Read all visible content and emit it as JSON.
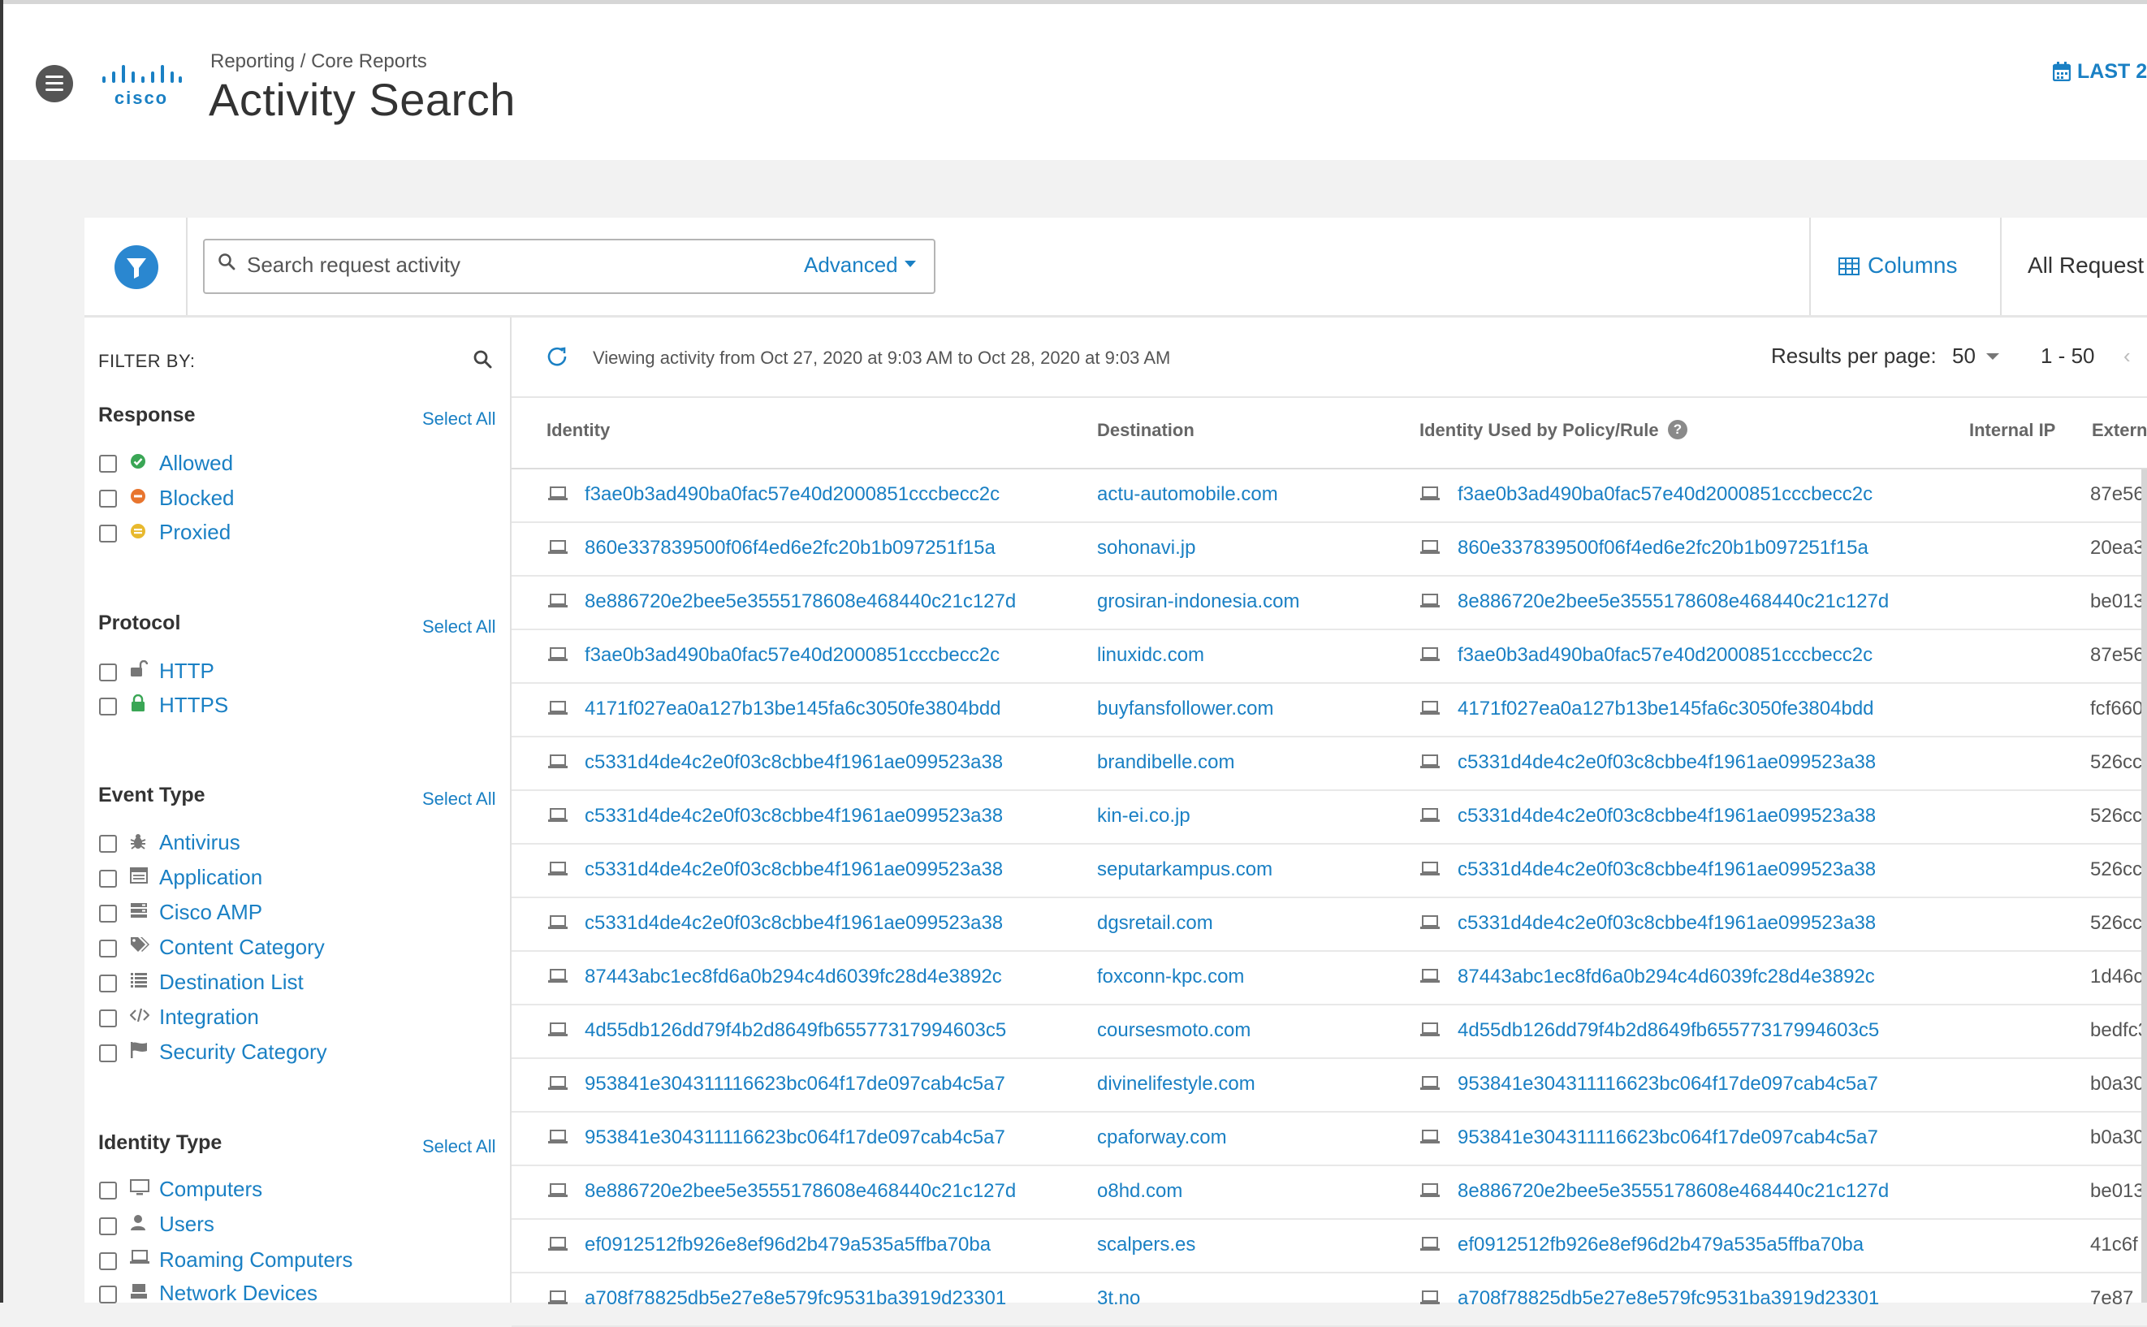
{
  "header": {
    "breadcrumb": "Reporting / Core Reports",
    "title": "Activity Search",
    "date_range": "LAST 2"
  },
  "toolbar": {
    "search_placeholder": "Search request activity",
    "advanced_label": "Advanced",
    "columns_label": "Columns",
    "all_requests_label": "All Request"
  },
  "sidebar": {
    "filter_by": "FILTER BY:",
    "sections": [
      {
        "title": "Response",
        "select_all": "Select All",
        "options": [
          {
            "label": "Allowed",
            "icon": "check-circle-icon",
            "color": "#3aa655"
          },
          {
            "label": "Blocked",
            "icon": "minus-circle-icon",
            "color": "#e8752e"
          },
          {
            "label": "Proxied",
            "icon": "proxy-circle-icon",
            "color": "#e8b92e"
          }
        ]
      },
      {
        "title": "Protocol",
        "select_all": "Select All",
        "options": [
          {
            "label": "HTTP",
            "icon": "unlock-icon",
            "color": "#777777"
          },
          {
            "label": "HTTPS",
            "icon": "lock-icon",
            "color": "#3aa655"
          }
        ]
      },
      {
        "title": "Event Type",
        "select_all": "Select All",
        "options": [
          {
            "label": "Antivirus",
            "icon": "bug-icon"
          },
          {
            "label": "Application",
            "icon": "application-icon"
          },
          {
            "label": "Cisco AMP",
            "icon": "server-icon"
          },
          {
            "label": "Content Category",
            "icon": "tags-icon"
          },
          {
            "label": "Destination List",
            "icon": "list-icon"
          },
          {
            "label": "Integration",
            "icon": "code-icon"
          },
          {
            "label": "Security Category",
            "icon": "flag-icon"
          }
        ]
      },
      {
        "title": "Identity Type",
        "select_all": "Select All",
        "options": [
          {
            "label": "Computers",
            "icon": "monitor-icon"
          },
          {
            "label": "Users",
            "icon": "user-icon"
          },
          {
            "label": "Roaming Computers",
            "icon": "laptop-icon"
          },
          {
            "label": "Network Devices",
            "icon": "network-device-icon"
          }
        ]
      }
    ]
  },
  "main": {
    "viewing_text": "Viewing activity from Oct 27, 2020 at 9:03 AM to Oct 28, 2020 at 9:03 AM",
    "results_per_page_label": "Results per page:",
    "results_per_page": "50",
    "page_range": "1 - 50",
    "columns": [
      "Identity",
      "Destination",
      "Identity Used by Policy/Rule",
      "Internal IP",
      "Extern"
    ],
    "rows": [
      {
        "identity": "f3ae0b3ad490ba0fac57e40d2000851cccbecc2c",
        "destination": "actu-automobile.com",
        "policy": "f3ae0b3ad490ba0fac57e40d2000851cccbecc2c",
        "external": "87e56"
      },
      {
        "identity": "860e337839500f06f4ed6e2fc20b1b097251f15a",
        "destination": "sohonavi.jp",
        "policy": "860e337839500f06f4ed6e2fc20b1b097251f15a",
        "external": "20ea3"
      },
      {
        "identity": "8e886720e2bee5e3555178608e468440c21c127d",
        "destination": "grosiran-indonesia.com",
        "policy": "8e886720e2bee5e3555178608e468440c21c127d",
        "external": "be013"
      },
      {
        "identity": "f3ae0b3ad490ba0fac57e40d2000851cccbecc2c",
        "destination": "linuxidc.com",
        "policy": "f3ae0b3ad490ba0fac57e40d2000851cccbecc2c",
        "external": "87e56"
      },
      {
        "identity": "4171f027ea0a127b13be145fa6c3050fe3804bdd",
        "destination": "buyfansfollower.com",
        "policy": "4171f027ea0a127b13be145fa6c3050fe3804bdd",
        "external": "fcf660"
      },
      {
        "identity": "c5331d4de4c2e0f03c8cbbe4f1961ae099523a38",
        "destination": "brandibelle.com",
        "policy": "c5331d4de4c2e0f03c8cbbe4f1961ae099523a38",
        "external": "526cc"
      },
      {
        "identity": "c5331d4de4c2e0f03c8cbbe4f1961ae099523a38",
        "destination": "kin-ei.co.jp",
        "policy": "c5331d4de4c2e0f03c8cbbe4f1961ae099523a38",
        "external": "526cc"
      },
      {
        "identity": "c5331d4de4c2e0f03c8cbbe4f1961ae099523a38",
        "destination": "seputarkampus.com",
        "policy": "c5331d4de4c2e0f03c8cbbe4f1961ae099523a38",
        "external": "526cc"
      },
      {
        "identity": "c5331d4de4c2e0f03c8cbbe4f1961ae099523a38",
        "destination": "dgsretail.com",
        "policy": "c5331d4de4c2e0f03c8cbbe4f1961ae099523a38",
        "external": "526cc"
      },
      {
        "identity": "87443abc1ec8fd6a0b294c4d6039fc28d4e3892c",
        "destination": "foxconn-kpc.com",
        "policy": "87443abc1ec8fd6a0b294c4d6039fc28d4e3892c",
        "external": "1d46c"
      },
      {
        "identity": "4d55db126dd79f4b2d8649fb65577317994603c5",
        "destination": "coursesmoto.com",
        "policy": "4d55db126dd79f4b2d8649fb65577317994603c5",
        "external": "bedfc3"
      },
      {
        "identity": "953841e304311116623bc064f17de097cab4c5a7",
        "destination": "divinelifestyle.com",
        "policy": "953841e304311116623bc064f17de097cab4c5a7",
        "external": "b0a30"
      },
      {
        "identity": "953841e304311116623bc064f17de097cab4c5a7",
        "destination": "cpaforway.com",
        "policy": "953841e304311116623bc064f17de097cab4c5a7",
        "external": "b0a30"
      },
      {
        "identity": "8e886720e2bee5e3555178608e468440c21c127d",
        "destination": "o8hd.com",
        "policy": "8e886720e2bee5e3555178608e468440c21c127d",
        "external": "be013"
      },
      {
        "identity": "ef0912512fb926e8ef96d2b479a535a5ffba70ba",
        "destination": "scalpers.es",
        "policy": "ef0912512fb926e8ef96d2b479a535a5ffba70ba",
        "external": "41c6f"
      },
      {
        "identity": "a708f78825db5e27e8e579fc9531ba3919d23301",
        "destination": "3t.no",
        "policy": "a708f78825db5e27e8e579fc9531ba3919d23301",
        "external": "7e87"
      }
    ]
  },
  "colors": {
    "accent": "#1a80c4",
    "filter_button": "#2a87d0",
    "allowed": "#3aa655",
    "blocked": "#e8752e",
    "proxied": "#e8b92e"
  }
}
